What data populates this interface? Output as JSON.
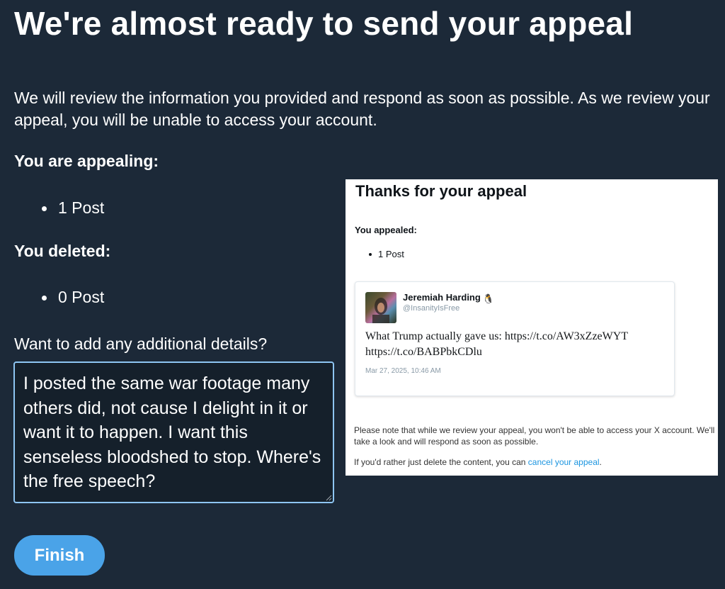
{
  "header": {
    "title": "We're almost ready to send your appeal"
  },
  "intro_text": "We will review the information you provided and respond as soon as possible. As we review your appeal, you will be unable to access your account.",
  "appealing": {
    "heading": "You are appealing:",
    "items": [
      "1 Post"
    ]
  },
  "deleted": {
    "heading": "You deleted:",
    "items": [
      "0 Post"
    ]
  },
  "details": {
    "label": "Want to add any additional details?",
    "value": "I posted the same war footage many others did, not cause I delight in it or want it to happen. I want this senseless bloodshed to stop. Where's the free speech?"
  },
  "finish_button": {
    "label": "Finish",
    "color": "#4aa3e8"
  },
  "embedded_screenshot": {
    "title": "Thanks for your appeal",
    "appealed_label": "You appealed:",
    "items": [
      "1 Post"
    ],
    "post": {
      "author_name": "Jeremiah Harding",
      "author_emoji": "🐧",
      "handle": "@InsanityIsFree",
      "text": "What Trump actually gave us: https://t.co/AW3xZzeWYT https://t.co/BABPbkCDlu",
      "date": "Mar 27, 2025, 10:46 AM"
    },
    "note": "Please note that while we review your appeal, you won't be able to access your X account. We'll take a look and will respond as soon as possible.",
    "cancel_prefix": "If you'd rather just delete the content, you can",
    "cancel_link": "cancel your appeal",
    "cancel_suffix": "."
  },
  "colors": {
    "background": "#1c2938",
    "textarea_border": "#8ec5f2",
    "link": "#1b95e0"
  }
}
